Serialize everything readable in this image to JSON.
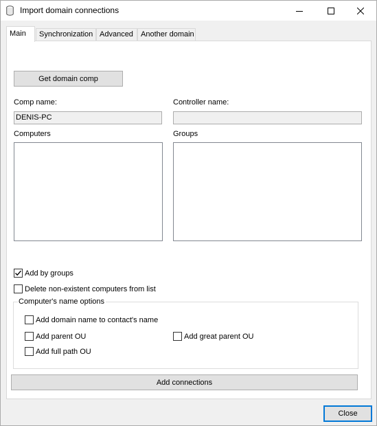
{
  "window": {
    "title": "Import domain connections",
    "icons": {
      "app": "cylinder-icon",
      "minimize": "minimize-icon",
      "maximize": "maximize-icon",
      "close": "close-icon"
    }
  },
  "tabs": [
    {
      "label": "Main",
      "active": true
    },
    {
      "label": "Synchronization",
      "active": false
    },
    {
      "label": "Advanced",
      "active": false
    },
    {
      "label": "Another domain",
      "active": false
    }
  ],
  "main": {
    "get_domain_comp_label": "Get domain comp",
    "comp_name_label": "Comp name:",
    "comp_name_value": "DENIS-PC",
    "controller_name_label": "Controller name:",
    "controller_name_value": "",
    "computers_label": "Computers",
    "groups_label": "Groups",
    "computers_items": [],
    "groups_items": [],
    "add_by_groups": {
      "label": "Add by groups",
      "checked": true
    },
    "delete_nonexistent": {
      "label": "Delete non-existent computers from list",
      "checked": false
    },
    "name_options": {
      "title": "Computer's name options",
      "add_domain_name": {
        "label": "Add domain name to contact's name",
        "checked": false
      },
      "add_parent_ou": {
        "label": "Add parent OU",
        "checked": false
      },
      "add_great_parent_ou": {
        "label": "Add great parent OU",
        "checked": false
      },
      "add_full_path_ou": {
        "label": "Add full path OU",
        "checked": false
      }
    },
    "add_connections_label": "Add connections"
  },
  "footer": {
    "close_label": "Close"
  },
  "colors": {
    "window_bg": "#f0f0f0",
    "panel_bg": "#ffffff",
    "button_bg": "#e1e1e1",
    "default_button_border": "#0078d7"
  }
}
